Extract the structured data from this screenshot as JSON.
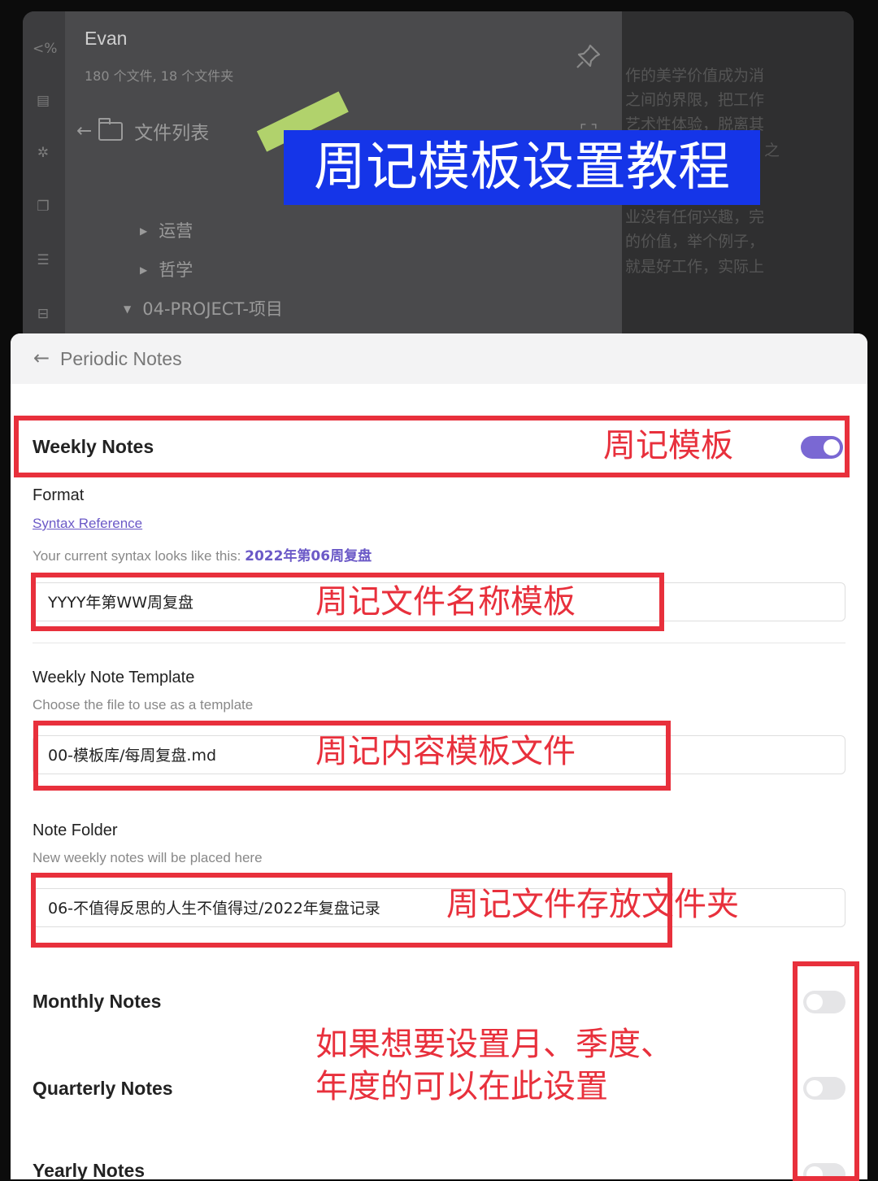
{
  "banner": {
    "title": "周记模板设置教程"
  },
  "vault": {
    "name": "Evan",
    "stats": "180 个文件, 18 个文件夹"
  },
  "file_panel": {
    "header": "文件列表",
    "tree": [
      {
        "label": "运营",
        "expanded": false
      },
      {
        "label": "哲学",
        "expanded": false
      },
      {
        "label": "04-PROJECT-项目",
        "expanded": true
      }
    ]
  },
  "ribbon": {
    "icons": [
      "code-icon",
      "graph-icon",
      "network-icon",
      "copy-icon",
      "slides-icon",
      "archive-icon"
    ]
  },
  "right_pane": {
    "lines": [
      "作的美学价值成为消",
      "之间的界限，把工作",
      "艺术性体验，脱离其",
      "之",
      "业没有任何兴趣，完",
      "的价值，举个例子，",
      "就是好工作，实际上"
    ]
  },
  "settings": {
    "back_label": "Periodic Notes",
    "weekly": {
      "title": "Weekly Notes",
      "enabled": true,
      "format_label": "Format",
      "syntax_link": "Syntax Reference",
      "syntax_preview_prefix": "Your current syntax looks like this: ",
      "syntax_preview_value": "2022年第06周复盘",
      "format_value": "YYYY年第WW周复盘",
      "template_label": "Weekly Note Template",
      "template_desc": "Choose the file to use as a template",
      "template_value": "00-模板库/每周复盘.md",
      "folder_label": "Note Folder",
      "folder_desc": "New weekly notes will be placed here",
      "folder_value": "06-不值得反思的人生不值得过/2022年复盘记录"
    },
    "monthly": {
      "title": "Monthly Notes",
      "enabled": false
    },
    "quarterly": {
      "title": "Quarterly Notes",
      "enabled": false
    },
    "yearly": {
      "title": "Yearly Notes",
      "enabled": false
    }
  },
  "annotations": {
    "weekly_template": "周记模板",
    "file_name_template": "周记文件名称模板",
    "content_template": "周记内容模板文件",
    "folder": "周记文件存放文件夹",
    "other_line1": "如果想要设置月、季度、",
    "other_line2": "年度的可以在此设置"
  },
  "colors": {
    "accent": "#7a68d3",
    "annotation_red": "#e8303c",
    "banner_blue": "#1535e8",
    "highlighter": "#b6d96e"
  }
}
